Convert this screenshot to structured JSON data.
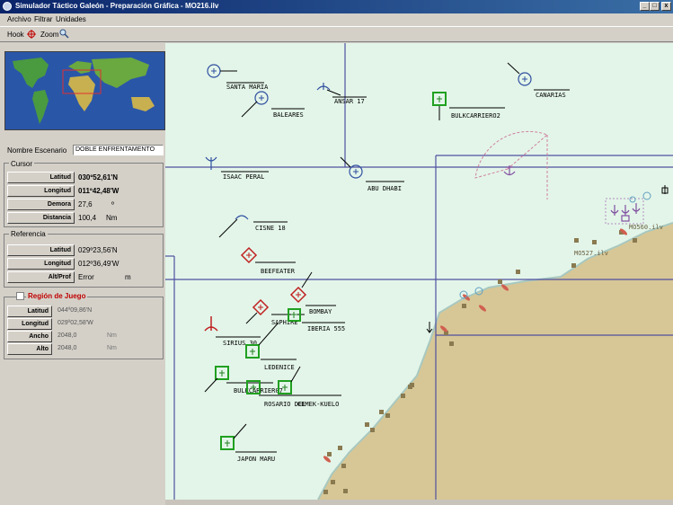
{
  "window": {
    "title": "Simulador Táctico Galeón - Preparación Gráfica - MO216.ilv",
    "minimize": "_",
    "maximize": "□",
    "close": "x"
  },
  "menu": {
    "items": [
      "Archivo",
      "Filtrar",
      "Unidades"
    ]
  },
  "toolbar": {
    "hook_label": "Hook",
    "zoom_label": "Zoom"
  },
  "scenario": {
    "label": "Nombre Escenario",
    "value": "DOBLE ENFRENTAMENTO"
  },
  "cursor": {
    "title": "Cursor",
    "rows": [
      {
        "label": "Latitud",
        "value": "030º52,61'N",
        "unit": ""
      },
      {
        "label": "Longitud",
        "value": "011º42,48'W",
        "unit": ""
      },
      {
        "label": "Demora",
        "value": "27,6",
        "unit": "º"
      },
      {
        "label": "Distancia",
        "value": "100,4",
        "unit": "Nm"
      }
    ]
  },
  "referencia": {
    "title": "Referencia",
    "rows": [
      {
        "label": "Latitud",
        "value": "029º23,56'N",
        "unit": ""
      },
      {
        "label": "Longitud",
        "value": "012º36,49'W",
        "unit": ""
      },
      {
        "label": "Alt/Prof",
        "value": "Error",
        "unit": "m"
      }
    ]
  },
  "region": {
    "title": "Región de Juego",
    "rows": [
      {
        "label": "Latitud",
        "value": "044º09,86'N",
        "unit": ""
      },
      {
        "label": "Longitud",
        "value": "029º02,58'W",
        "unit": ""
      },
      {
        "label": "Ancho",
        "value": "2048,0",
        "unit": "Nm"
      },
      {
        "label": "Alto",
        "value": "2048,0",
        "unit": "Nm"
      }
    ]
  },
  "map": {
    "units": [
      {
        "name": "SANTA MARIA",
        "kind": "air"
      },
      {
        "name": "BALEARES",
        "kind": "air"
      },
      {
        "name": "ANSAR 17",
        "kind": "heli"
      },
      {
        "name": "BULKCARRIERO2",
        "kind": "surface-green"
      },
      {
        "name": "CANARIAS",
        "kind": "air"
      },
      {
        "name": "ISAAC PERAL",
        "kind": "sub"
      },
      {
        "name": "ABU DHABI",
        "kind": "air"
      },
      {
        "name": "CISNE 18",
        "kind": "heli"
      },
      {
        "name": "BEEFEATER",
        "kind": "hostile"
      },
      {
        "name": "BOMBAY",
        "kind": "hostile"
      },
      {
        "name": "SAPHIRE",
        "kind": "hostile"
      },
      {
        "name": "IBERIA 555",
        "kind": "surface-green"
      },
      {
        "name": "SIRIUS 30",
        "kind": "sub-red"
      },
      {
        "name": "LEDENICE",
        "kind": "surface-green"
      },
      {
        "name": "BULKCARRIER07",
        "kind": "surface-green"
      },
      {
        "name": "ROSARIO DEL",
        "kind": "surface-green"
      },
      {
        "name": "CEMEK-KUELO",
        "kind": "surface-green"
      },
      {
        "name": "JAPON MARU",
        "kind": "surface-green"
      }
    ],
    "land_labels": [
      "MO527.ilv",
      "MO560.ilv"
    ]
  }
}
